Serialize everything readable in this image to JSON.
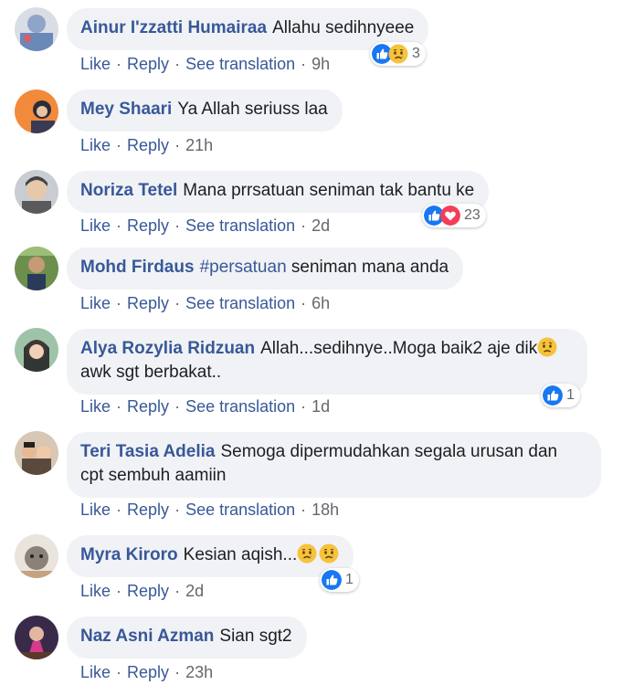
{
  "actions": {
    "like": "Like",
    "reply": "Reply",
    "see_translation": "See translation",
    "separator": "·"
  },
  "comments": [
    {
      "author": "Ainur I'zzatti Humairaa",
      "text": "Allahu sedihnyeee",
      "time": "9h",
      "reactions": [
        "like-icon",
        "sad-icon"
      ],
      "reaction_count": "3"
    },
    {
      "author": "Mey Shaari",
      "text": "Ya Allah seriuss laa",
      "time": "21h"
    },
    {
      "author": "Noriza Tetel",
      "text": "Mana prrsatuan seniman tak bantu ke",
      "time": "2d",
      "reactions": [
        "like-icon",
        "love-icon"
      ],
      "reaction_count": "23"
    },
    {
      "author": "Mohd Firdaus",
      "hashtag": "#persatuan",
      "text": "seniman mana anda",
      "time": "6h"
    },
    {
      "author": "Alya Rozylia Ridzuan",
      "text": "Allah...sedihnye..Moga baik2 aje dik",
      "text2": "awk sgt berbakat..",
      "time": "1d",
      "reactions": [
        "like-icon"
      ],
      "reaction_count": "1"
    },
    {
      "author": "Teri Tasia Adelia",
      "text": "Semoga dipermudahkan segala urusan dan",
      "text2": "cpt sembuh aamiin",
      "time": "18h"
    },
    {
      "author": "Myra Kiroro",
      "text": "Kesian aqish...",
      "time": "2d",
      "reactions": [
        "like-icon"
      ],
      "reaction_count": "1"
    },
    {
      "author": "Naz Asni Azman",
      "text": "Sian sgt2",
      "time": "23h"
    }
  ],
  "colors": {
    "author": "#385898",
    "bubble": "#f0f2f5",
    "meta": "#65676b",
    "like_blue": "#1877f2",
    "love_red": "#f33e58"
  }
}
